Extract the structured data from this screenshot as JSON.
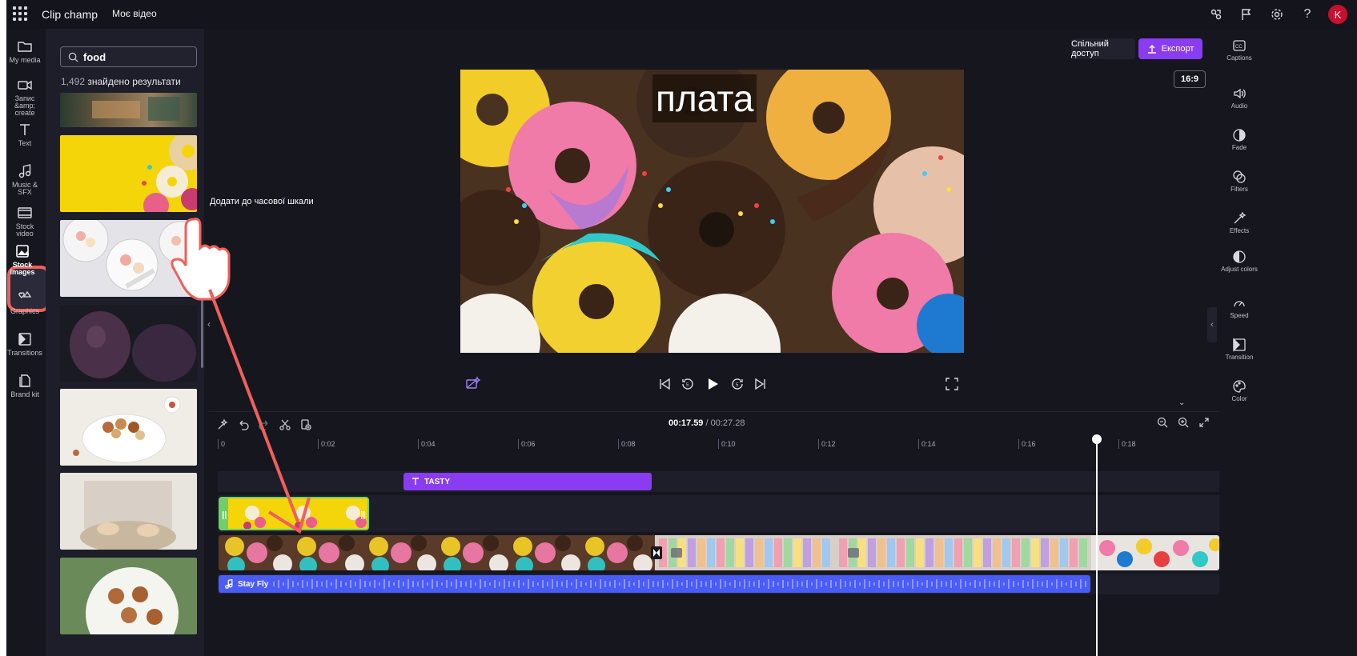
{
  "app": {
    "title": "Clip champ",
    "project_name": "Моє відео",
    "avatar_initial": "K"
  },
  "leftnav": [
    {
      "label": "My media",
      "icon": "folder-icon"
    },
    {
      "label": "Запис &amp; create",
      "icon": "camera-icon"
    },
    {
      "label": "Text",
      "icon": "text-icon"
    },
    {
      "label": "Music & SFX",
      "icon": "music-icon"
    },
    {
      "label": "Stock video",
      "icon": "film-icon"
    },
    {
      "label": "Stock images",
      "icon": "image-icon"
    },
    {
      "label": "Graphics",
      "icon": "shapes-icon"
    },
    {
      "label": "Transitions",
      "icon": "transitions-icon"
    },
    {
      "label": "Brand kit",
      "icon": "brand-icon"
    }
  ],
  "media": {
    "search_value": "food",
    "results_count": "1,492",
    "results_label": "знайдено результати",
    "tooltip": "Додати до часової шкали"
  },
  "preview": {
    "title_text": "плата",
    "ratio": "16:9"
  },
  "header_buttons": {
    "share": "Спільний доступ",
    "export": "Експорт"
  },
  "rightnav": [
    {
      "label": "Captions",
      "icon": "captions-icon"
    },
    {
      "label": "Audio",
      "icon": "speaker-icon"
    },
    {
      "label": "Fade",
      "icon": "fade-icon"
    },
    {
      "label": "Filters",
      "icon": "filters-icon"
    },
    {
      "label": "Effects",
      "icon": "wand-icon"
    },
    {
      "label": "Adjust colors",
      "icon": "contrast-icon"
    },
    {
      "label": "Speed",
      "icon": "speed-icon"
    },
    {
      "label": "Transition",
      "icon": "transition-icon"
    },
    {
      "label": "Color",
      "icon": "palette-icon"
    }
  ],
  "timeline": {
    "current_time": "00:17.59",
    "total_time": "/ 00:27.28",
    "ticks": [
      "0",
      "0:02",
      "0:04",
      "0:06",
      "0:08",
      "0:10",
      "0:12",
      "0:14",
      "0:16",
      "0:18"
    ],
    "text_clip": "TASTY",
    "audio_clip": "Stay Fly"
  },
  "colors": {
    "accent": "#8a3cf0",
    "audio": "#4a5cf5",
    "highlight": "#f0605a",
    "selected_clip": "#6ecf6a"
  }
}
